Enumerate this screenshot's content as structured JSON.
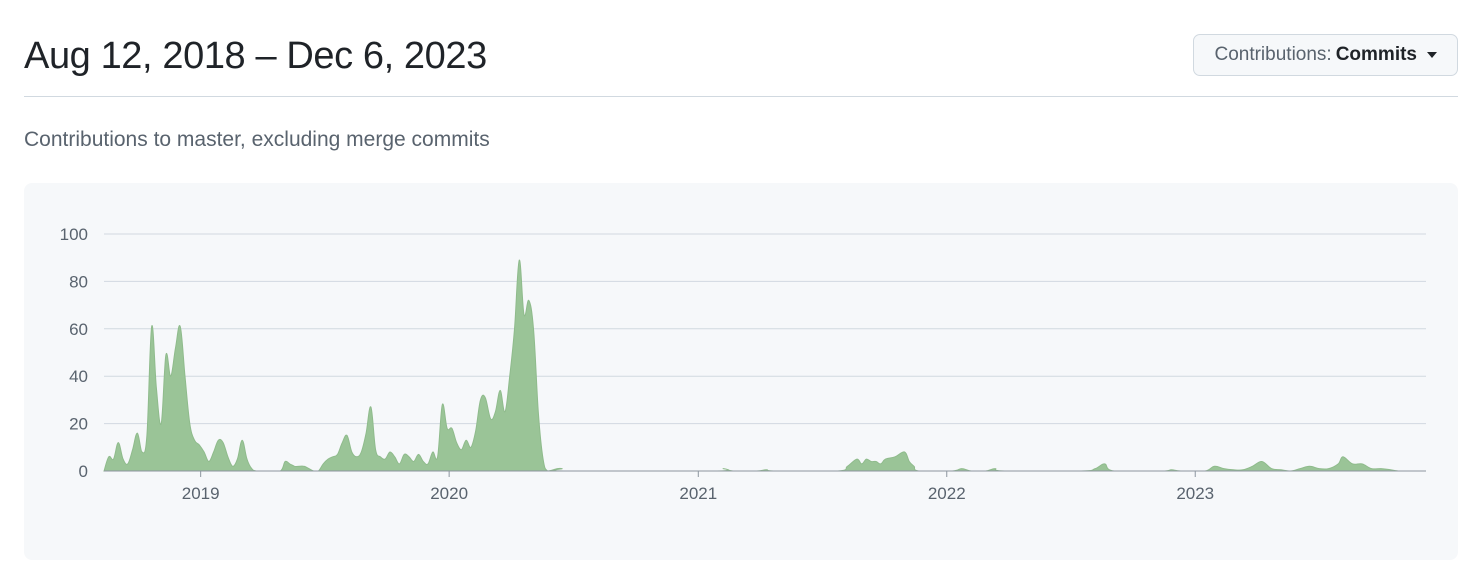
{
  "header": {
    "range_title": "Aug 12, 2018 – Dec 6, 2023",
    "contributions_label": "Contributions:",
    "contributions_value": "Commits"
  },
  "subtitle": "Contributions to master, excluding merge commits",
  "colors": {
    "area_fill": "#9ac497",
    "area_stroke": "#8fbb8c",
    "gridline": "#d1d9e0",
    "panel_bg": "#f6f8fa"
  },
  "chart_data": {
    "type": "area",
    "title": "",
    "xlabel": "",
    "ylabel": "",
    "xlim": [
      "2018-08-12",
      "2023-12-06"
    ],
    "ylim": [
      0,
      100
    ],
    "yticks": [
      0,
      20,
      40,
      60,
      80,
      100
    ],
    "yticklabels": [
      "0",
      "20",
      "40",
      "60",
      "80",
      "100"
    ],
    "xticks": [
      "2019-01-01",
      "2020-01-01",
      "2021-01-01",
      "2022-01-01",
      "2023-01-01"
    ],
    "xticklabels": [
      "2019",
      "2020",
      "2021",
      "2022",
      "2023"
    ],
    "grid": true,
    "series": [
      {
        "points": [
          [
            "2018-08-12",
            0
          ],
          [
            "2018-08-19",
            6
          ],
          [
            "2018-08-26",
            5
          ],
          [
            "2018-09-02",
            12
          ],
          [
            "2018-09-09",
            5
          ],
          [
            "2018-09-16",
            3
          ],
          [
            "2018-09-23",
            9
          ],
          [
            "2018-09-30",
            16
          ],
          [
            "2018-10-07",
            8
          ],
          [
            "2018-10-14",
            15
          ],
          [
            "2018-10-21",
            61
          ],
          [
            "2018-10-28",
            35
          ],
          [
            "2018-11-04",
            20
          ],
          [
            "2018-11-11",
            49
          ],
          [
            "2018-11-18",
            40
          ],
          [
            "2018-11-25",
            52
          ],
          [
            "2018-12-02",
            61
          ],
          [
            "2018-12-09",
            40
          ],
          [
            "2018-12-16",
            20
          ],
          [
            "2018-12-23",
            13
          ],
          [
            "2018-12-30",
            11
          ],
          [
            "2019-01-06",
            8
          ],
          [
            "2019-01-13",
            4
          ],
          [
            "2019-01-20",
            8
          ],
          [
            "2019-01-27",
            13
          ],
          [
            "2019-02-03",
            12
          ],
          [
            "2019-02-10",
            6
          ],
          [
            "2019-02-17",
            2
          ],
          [
            "2019-02-24",
            5
          ],
          [
            "2019-03-03",
            13
          ],
          [
            "2019-03-10",
            5
          ],
          [
            "2019-03-17",
            1
          ],
          [
            "2019-03-24",
            0
          ],
          [
            "2019-04-07",
            0
          ],
          [
            "2019-04-28",
            0
          ],
          [
            "2019-05-05",
            4
          ],
          [
            "2019-05-12",
            3
          ],
          [
            "2019-05-19",
            2
          ],
          [
            "2019-05-26",
            2
          ],
          [
            "2019-06-02",
            2
          ],
          [
            "2019-06-09",
            1
          ],
          [
            "2019-06-16",
            0
          ],
          [
            "2019-06-23",
            0
          ],
          [
            "2019-06-30",
            3
          ],
          [
            "2019-07-07",
            5
          ],
          [
            "2019-07-14",
            6
          ],
          [
            "2019-07-21",
            7
          ],
          [
            "2019-07-28",
            12
          ],
          [
            "2019-08-04",
            15
          ],
          [
            "2019-08-11",
            8
          ],
          [
            "2019-08-18",
            6
          ],
          [
            "2019-08-25",
            8
          ],
          [
            "2019-09-01",
            16
          ],
          [
            "2019-09-08",
            27
          ],
          [
            "2019-09-15",
            9
          ],
          [
            "2019-09-22",
            6
          ],
          [
            "2019-09-29",
            5
          ],
          [
            "2019-10-06",
            8
          ],
          [
            "2019-10-13",
            6
          ],
          [
            "2019-10-20",
            3
          ],
          [
            "2019-10-27",
            7
          ],
          [
            "2019-11-03",
            6
          ],
          [
            "2019-11-10",
            4
          ],
          [
            "2019-11-17",
            7
          ],
          [
            "2019-11-24",
            4
          ],
          [
            "2019-12-01",
            3
          ],
          [
            "2019-12-08",
            8
          ],
          [
            "2019-12-15",
            6
          ],
          [
            "2019-12-22",
            28
          ],
          [
            "2019-12-29",
            18
          ],
          [
            "2020-01-05",
            18
          ],
          [
            "2020-01-12",
            12
          ],
          [
            "2020-01-19",
            9
          ],
          [
            "2020-01-26",
            13
          ],
          [
            "2020-02-02",
            10
          ],
          [
            "2020-02-09",
            17
          ],
          [
            "2020-02-16",
            30
          ],
          [
            "2020-02-23",
            31
          ],
          [
            "2020-03-02",
            22
          ],
          [
            "2020-03-09",
            25
          ],
          [
            "2020-03-16",
            34
          ],
          [
            "2020-03-23",
            25
          ],
          [
            "2020-03-30",
            40
          ],
          [
            "2020-04-06",
            60
          ],
          [
            "2020-04-13",
            89
          ],
          [
            "2020-04-20",
            66
          ],
          [
            "2020-04-27",
            72
          ],
          [
            "2020-05-04",
            60
          ],
          [
            "2020-05-11",
            25
          ],
          [
            "2020-05-18",
            5
          ],
          [
            "2020-05-25",
            0
          ],
          [
            "2020-06-08",
            1
          ],
          [
            "2020-06-15",
            1
          ],
          [
            "2020-06-22",
            0
          ],
          [
            "2021-01-24",
            0
          ],
          [
            "2021-02-07",
            1
          ],
          [
            "2021-02-21",
            0
          ],
          [
            "2021-03-28",
            0
          ],
          [
            "2021-04-11",
            0.5
          ],
          [
            "2021-04-25",
            0
          ],
          [
            "2021-07-25",
            0
          ],
          [
            "2021-08-08",
            2
          ],
          [
            "2021-08-22",
            5
          ],
          [
            "2021-08-29",
            3
          ],
          [
            "2021-09-05",
            5
          ],
          [
            "2021-09-12",
            4
          ],
          [
            "2021-09-19",
            4
          ],
          [
            "2021-09-26",
            3
          ],
          [
            "2021-10-03",
            5
          ],
          [
            "2021-10-17",
            6
          ],
          [
            "2021-10-31",
            8
          ],
          [
            "2021-11-07",
            4
          ],
          [
            "2021-11-14",
            2
          ],
          [
            "2021-11-21",
            0
          ],
          [
            "2022-01-09",
            0
          ],
          [
            "2022-01-23",
            1
          ],
          [
            "2022-02-06",
            0
          ],
          [
            "2022-02-27",
            0
          ],
          [
            "2022-03-13",
            1
          ],
          [
            "2022-03-27",
            0
          ],
          [
            "2022-07-17",
            0
          ],
          [
            "2022-08-07",
            1
          ],
          [
            "2022-08-21",
            3
          ],
          [
            "2022-09-04",
            0
          ],
          [
            "2022-11-13",
            0
          ],
          [
            "2022-11-27",
            0.5
          ],
          [
            "2022-12-11",
            0
          ],
          [
            "2023-01-15",
            0
          ],
          [
            "2023-01-29",
            2
          ],
          [
            "2023-02-12",
            1
          ],
          [
            "2023-02-26",
            0.5
          ],
          [
            "2023-03-12",
            0.5
          ],
          [
            "2023-03-26",
            2
          ],
          [
            "2023-04-09",
            4
          ],
          [
            "2023-04-23",
            1
          ],
          [
            "2023-05-07",
            0.5
          ],
          [
            "2023-05-21",
            0
          ],
          [
            "2023-06-04",
            1
          ],
          [
            "2023-06-18",
            2
          ],
          [
            "2023-07-02",
            1
          ],
          [
            "2023-07-16",
            1
          ],
          [
            "2023-07-30",
            3
          ],
          [
            "2023-08-06",
            6
          ],
          [
            "2023-08-20",
            3
          ],
          [
            "2023-09-03",
            3
          ],
          [
            "2023-09-17",
            1
          ],
          [
            "2023-10-01",
            1
          ],
          [
            "2023-10-15",
            0.5
          ],
          [
            "2023-10-29",
            0
          ],
          [
            "2023-12-06",
            0
          ]
        ]
      }
    ]
  }
}
